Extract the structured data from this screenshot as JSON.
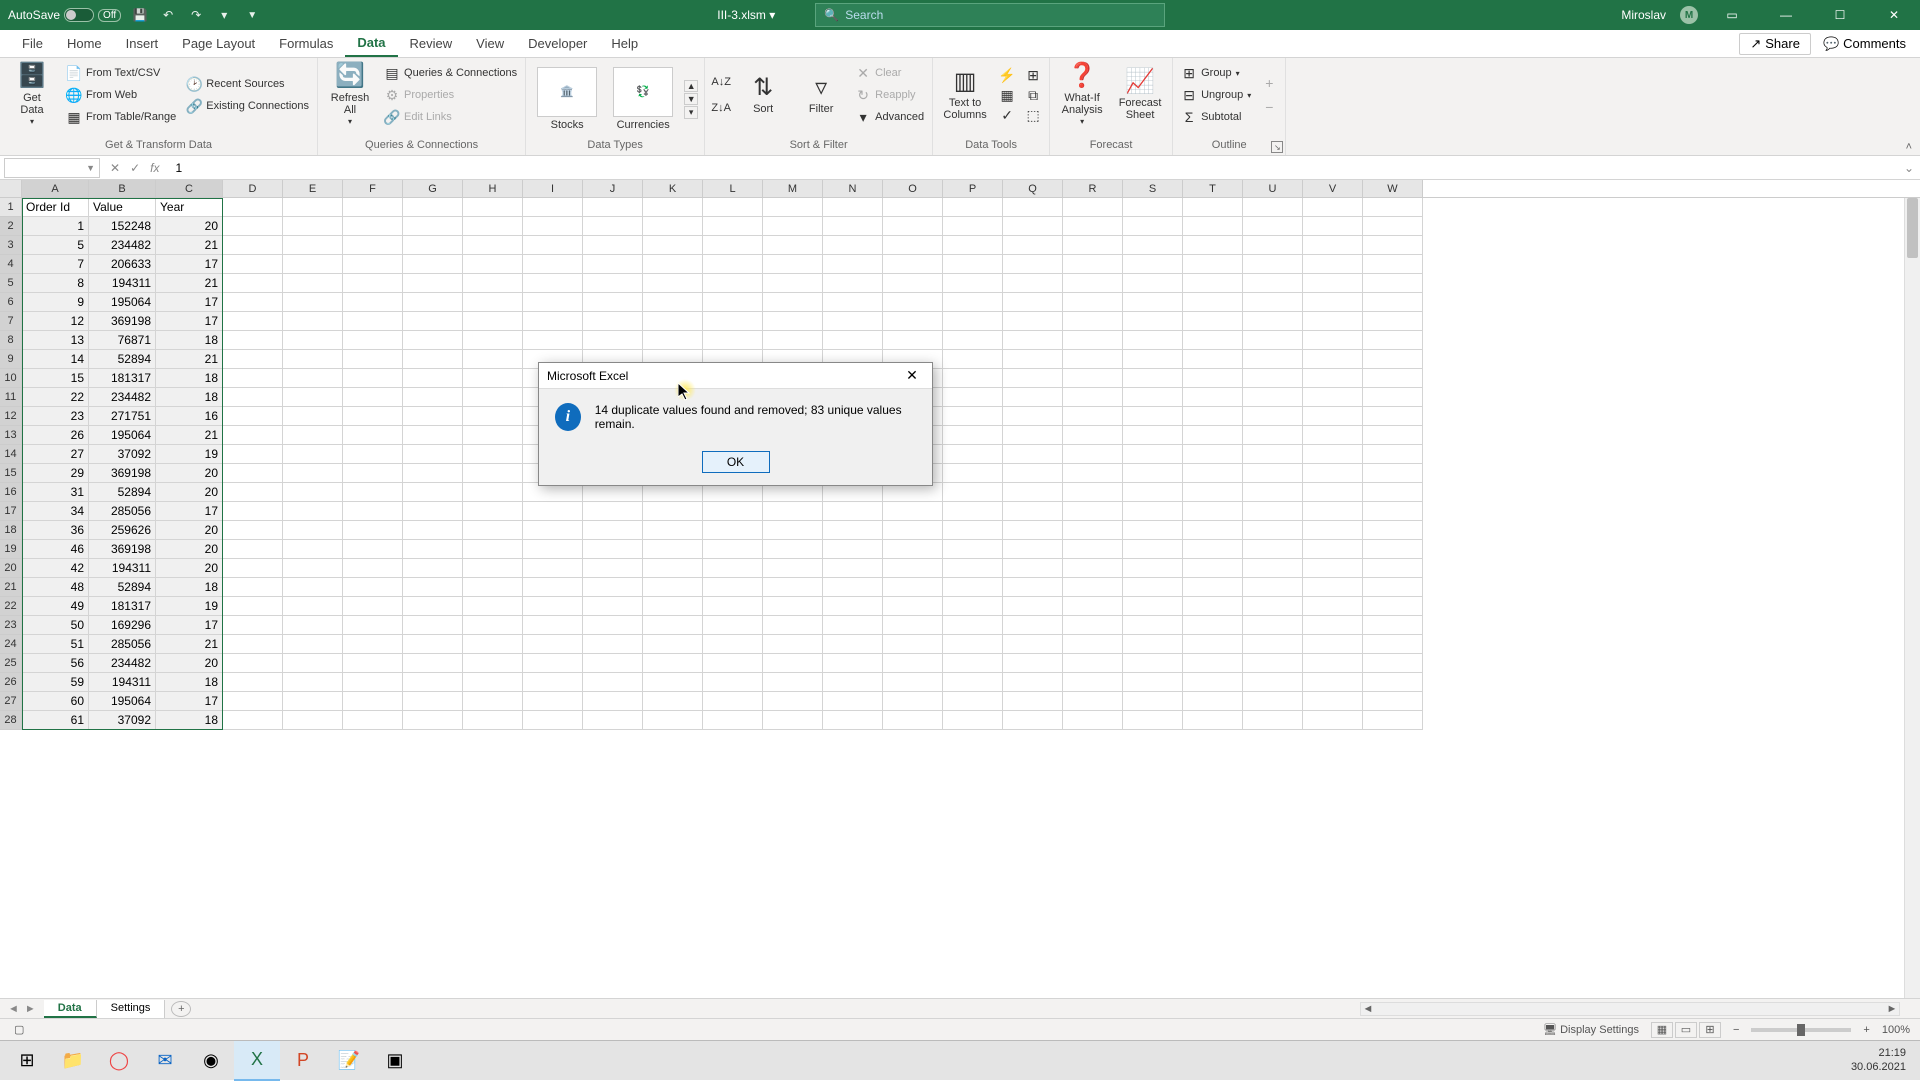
{
  "titlebar": {
    "autosave_label": "AutoSave",
    "autosave_state": "Off",
    "filename": "III-3.xlsm",
    "search_placeholder": "Search",
    "user_name": "Miroslav",
    "user_initial": "M"
  },
  "tabs": [
    "File",
    "Home",
    "Insert",
    "Page Layout",
    "Formulas",
    "Data",
    "Review",
    "View",
    "Developer",
    "Help"
  ],
  "active_tab": "Data",
  "share_label": "Share",
  "comments_label": "Comments",
  "ribbon_groups": {
    "get_transform": {
      "label": "Get & Transform Data",
      "get_data": "Get\nData",
      "items": [
        "From Text/CSV",
        "From Web",
        "From Table/Range",
        "Recent Sources",
        "Existing Connections"
      ]
    },
    "queries": {
      "label": "Queries & Connections",
      "refresh": "Refresh\nAll",
      "items": [
        "Queries & Connections",
        "Properties",
        "Edit Links"
      ]
    },
    "data_types": {
      "label": "Data Types",
      "stocks": "Stocks",
      "currencies": "Currencies"
    },
    "sort_filter": {
      "label": "Sort & Filter",
      "sort": "Sort",
      "filter": "Filter",
      "clear": "Clear",
      "reapply": "Reapply",
      "advanced": "Advanced"
    },
    "data_tools": {
      "label": "Data Tools",
      "text_cols": "Text to\nColumns"
    },
    "forecast": {
      "label": "Forecast",
      "whatif": "What-If\nAnalysis",
      "sheet": "Forecast\nSheet"
    },
    "outline": {
      "label": "Outline",
      "group": "Group",
      "ungroup": "Ungroup",
      "subtotal": "Subtotal"
    }
  },
  "name_box": "",
  "formula_value": "1",
  "columns": [
    "A",
    "B",
    "C",
    "D",
    "E",
    "F",
    "G",
    "H",
    "I",
    "J",
    "K",
    "L",
    "M",
    "N",
    "O",
    "P",
    "Q",
    "R",
    "S",
    "T",
    "U",
    "V",
    "W"
  ],
  "col_widths": {
    "A": 67,
    "B": 67,
    "C": 67,
    "other": 60
  },
  "headers": [
    "Order Id",
    "Value",
    "Year"
  ],
  "rows": [
    {
      "n": 1
    },
    {
      "n": 2,
      "a": "1",
      "b": "152248",
      "c": "20"
    },
    {
      "n": 3,
      "a": "5",
      "b": "234482",
      "c": "21"
    },
    {
      "n": 4,
      "a": "7",
      "b": "206633",
      "c": "17"
    },
    {
      "n": 5,
      "a": "8",
      "b": "194311",
      "c": "21"
    },
    {
      "n": 6,
      "a": "9",
      "b": "195064",
      "c": "17"
    },
    {
      "n": 7,
      "a": "12",
      "b": "369198",
      "c": "17"
    },
    {
      "n": 8,
      "a": "13",
      "b": "76871",
      "c": "18"
    },
    {
      "n": 9,
      "a": "14",
      "b": "52894",
      "c": "21"
    },
    {
      "n": 10,
      "a": "15",
      "b": "181317",
      "c": "18"
    },
    {
      "n": 11,
      "a": "22",
      "b": "234482",
      "c": "18"
    },
    {
      "n": 12,
      "a": "23",
      "b": "271751",
      "c": "16"
    },
    {
      "n": 13,
      "a": "26",
      "b": "195064",
      "c": "21"
    },
    {
      "n": 14,
      "a": "27",
      "b": "37092",
      "c": "19"
    },
    {
      "n": 15,
      "a": "29",
      "b": "369198",
      "c": "20"
    },
    {
      "n": 16,
      "a": "31",
      "b": "52894",
      "c": "20"
    },
    {
      "n": 17,
      "a": "34",
      "b": "285056",
      "c": "17"
    },
    {
      "n": 18,
      "a": "36",
      "b": "259626",
      "c": "20"
    },
    {
      "n": 19,
      "a": "46",
      "b": "369198",
      "c": "20"
    },
    {
      "n": 20,
      "a": "42",
      "b": "194311",
      "c": "20"
    },
    {
      "n": 21,
      "a": "48",
      "b": "52894",
      "c": "18"
    },
    {
      "n": 22,
      "a": "49",
      "b": "181317",
      "c": "19"
    },
    {
      "n": 23,
      "a": "50",
      "b": "169296",
      "c": "17"
    },
    {
      "n": 24,
      "a": "51",
      "b": "285056",
      "c": "21"
    },
    {
      "n": 25,
      "a": "56",
      "b": "234482",
      "c": "20"
    },
    {
      "n": 26,
      "a": "59",
      "b": "194311",
      "c": "18"
    },
    {
      "n": 27,
      "a": "60",
      "b": "195064",
      "c": "17"
    },
    {
      "n": 28,
      "a": "61",
      "b": "37092",
      "c": "18"
    }
  ],
  "sheets": [
    "Data",
    "Settings"
  ],
  "active_sheet": "Data",
  "status": {
    "display_settings": "Display Settings",
    "zoom": "100%"
  },
  "dialog": {
    "title": "Microsoft Excel",
    "message": "14 duplicate values found and removed; 83 unique values remain.",
    "ok": "OK"
  },
  "clock": {
    "time": "21:19",
    "date": "30.06.2021"
  }
}
